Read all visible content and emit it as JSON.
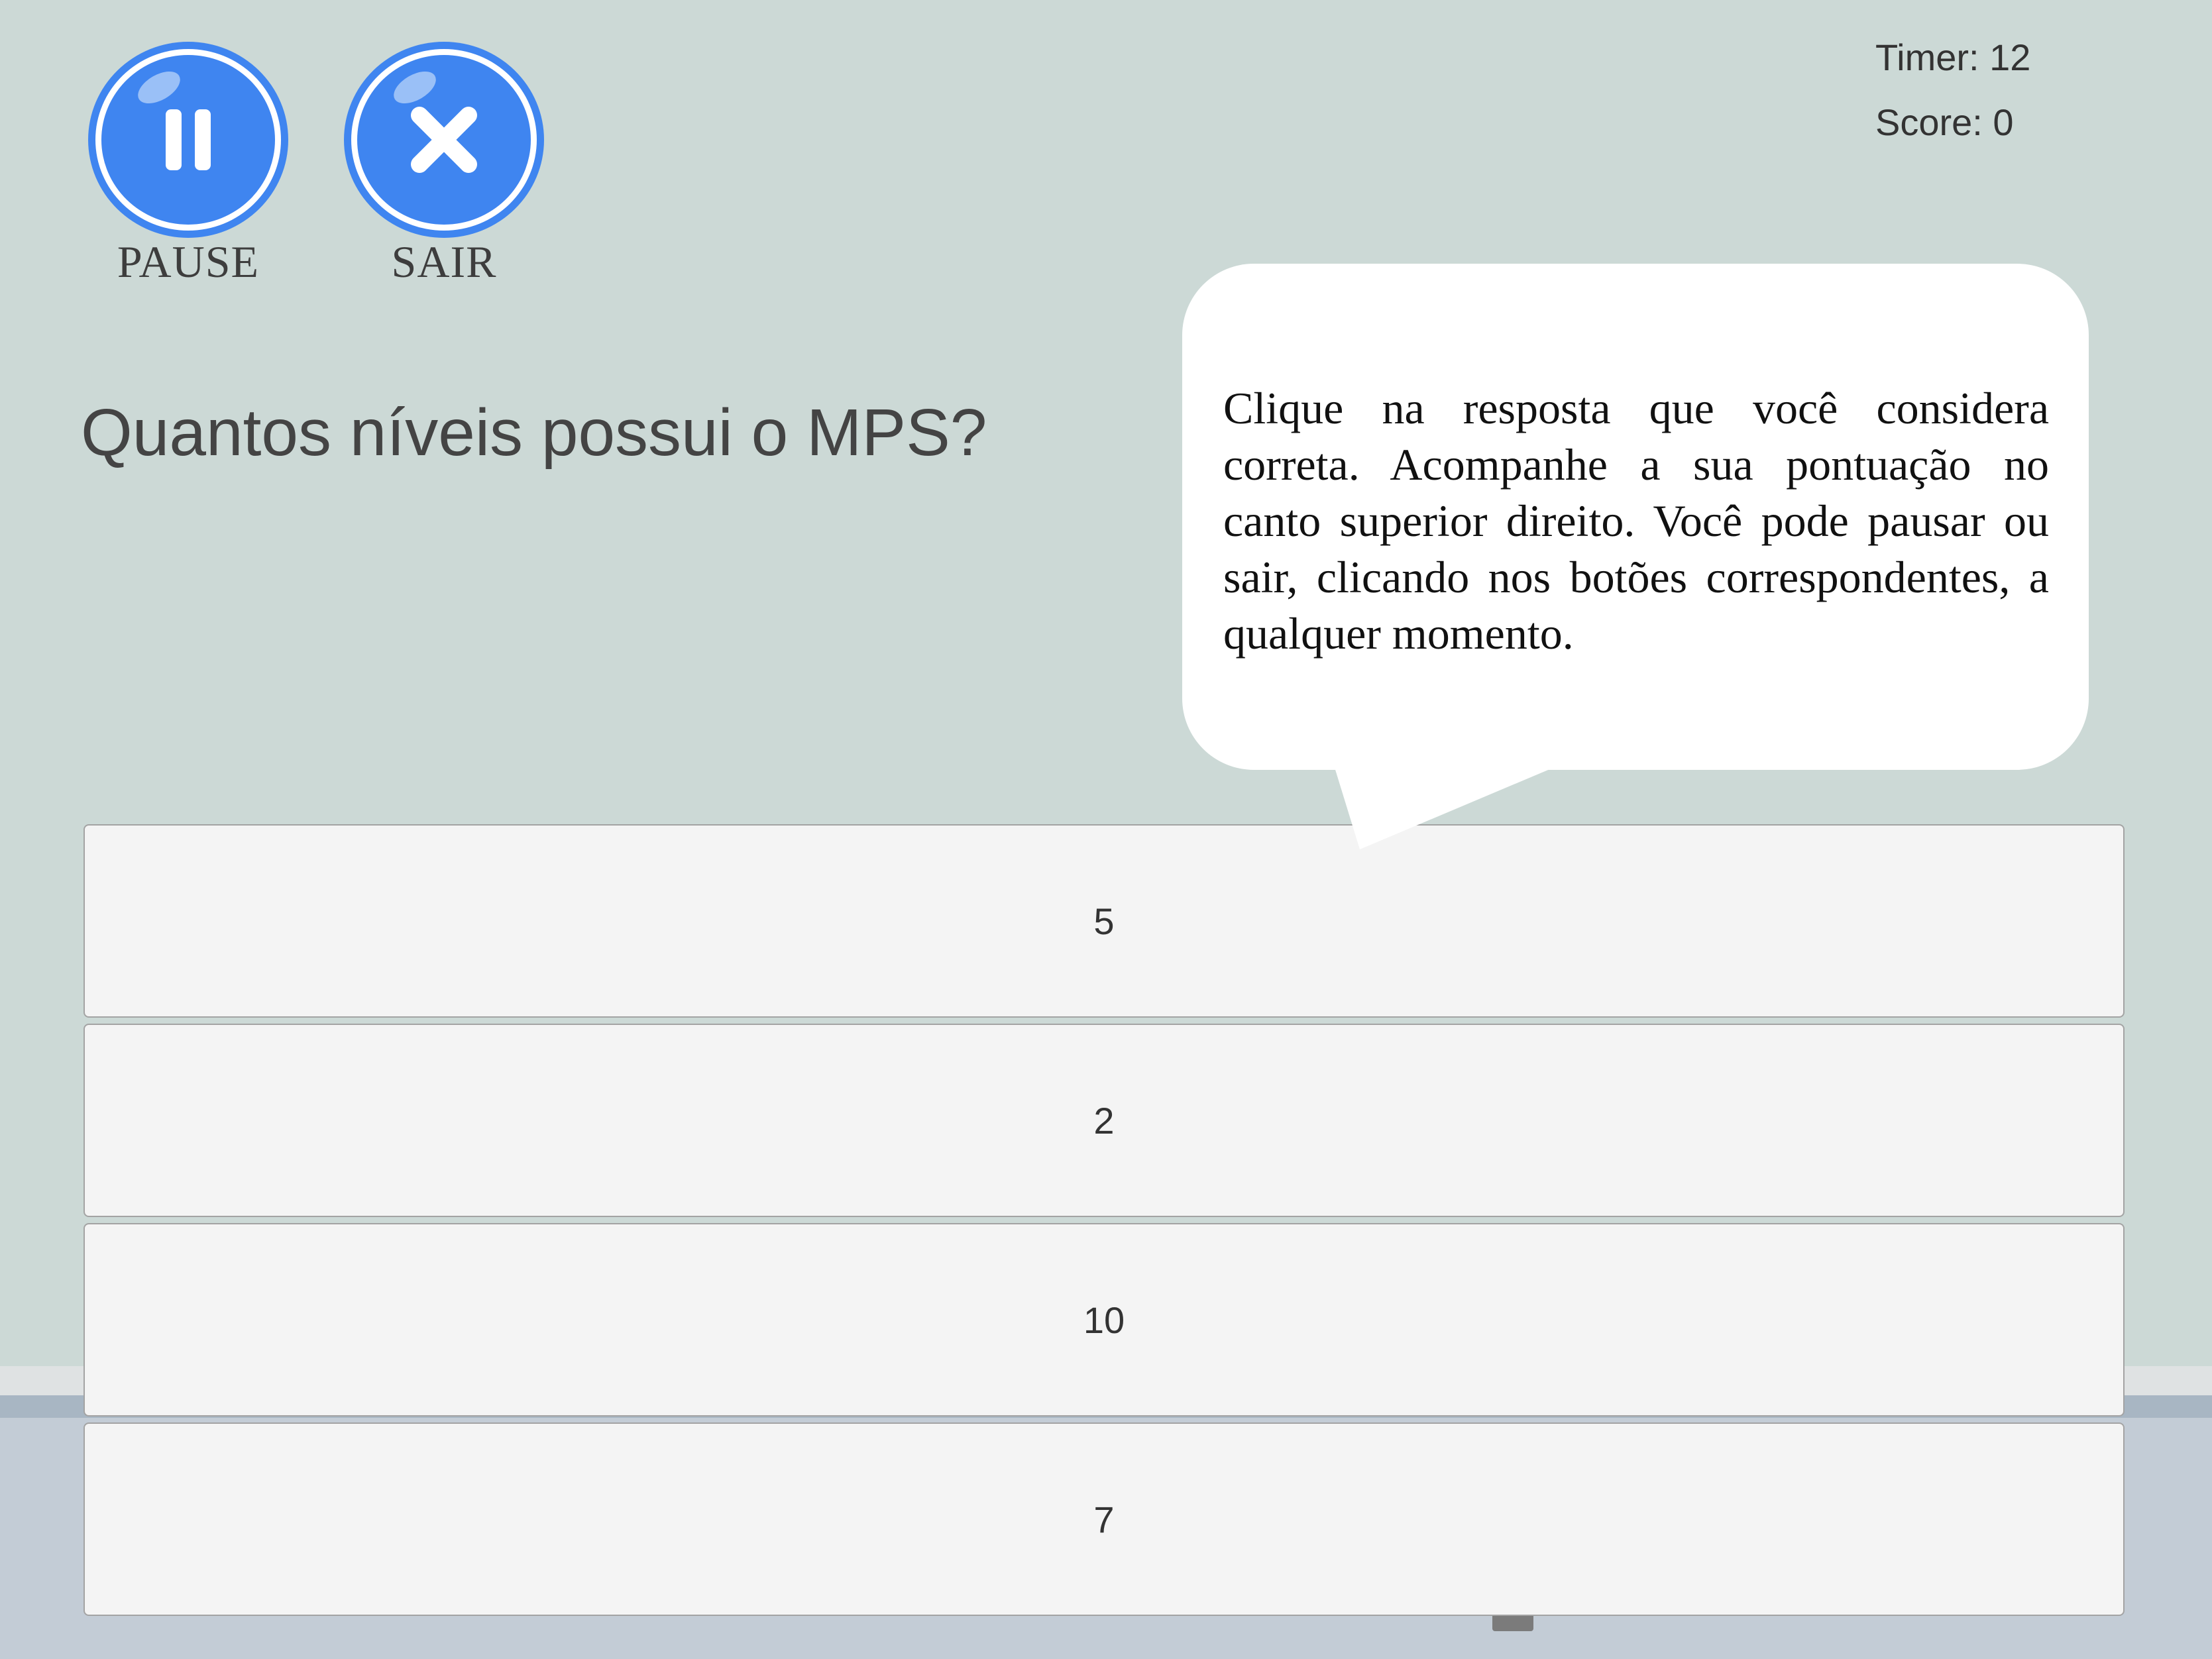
{
  "controls": {
    "pause_label": "PAUSE",
    "exit_label": "SAIR"
  },
  "hud": {
    "timer": "Timer: 12",
    "score": "Score: 0"
  },
  "question": {
    "text": "Quantos níveis possui o MPS?"
  },
  "answers": [
    {
      "label": "5"
    },
    {
      "label": "2"
    },
    {
      "label": "10"
    },
    {
      "label": "7"
    }
  ],
  "tutorial_bubble": {
    "text": "Clique na resposta que você considera correta. Acompanhe a sua pontuação no canto superior direito. Você pode pausar ou sair, clicando nos botões correspondentes, a qualquer momento."
  },
  "colors": {
    "background": "#ccd9d6",
    "button_blue": "#3f85f0",
    "answer_fill": "#f4f4f4"
  },
  "icons": {
    "pause": "pause-icon",
    "exit": "close-icon"
  }
}
